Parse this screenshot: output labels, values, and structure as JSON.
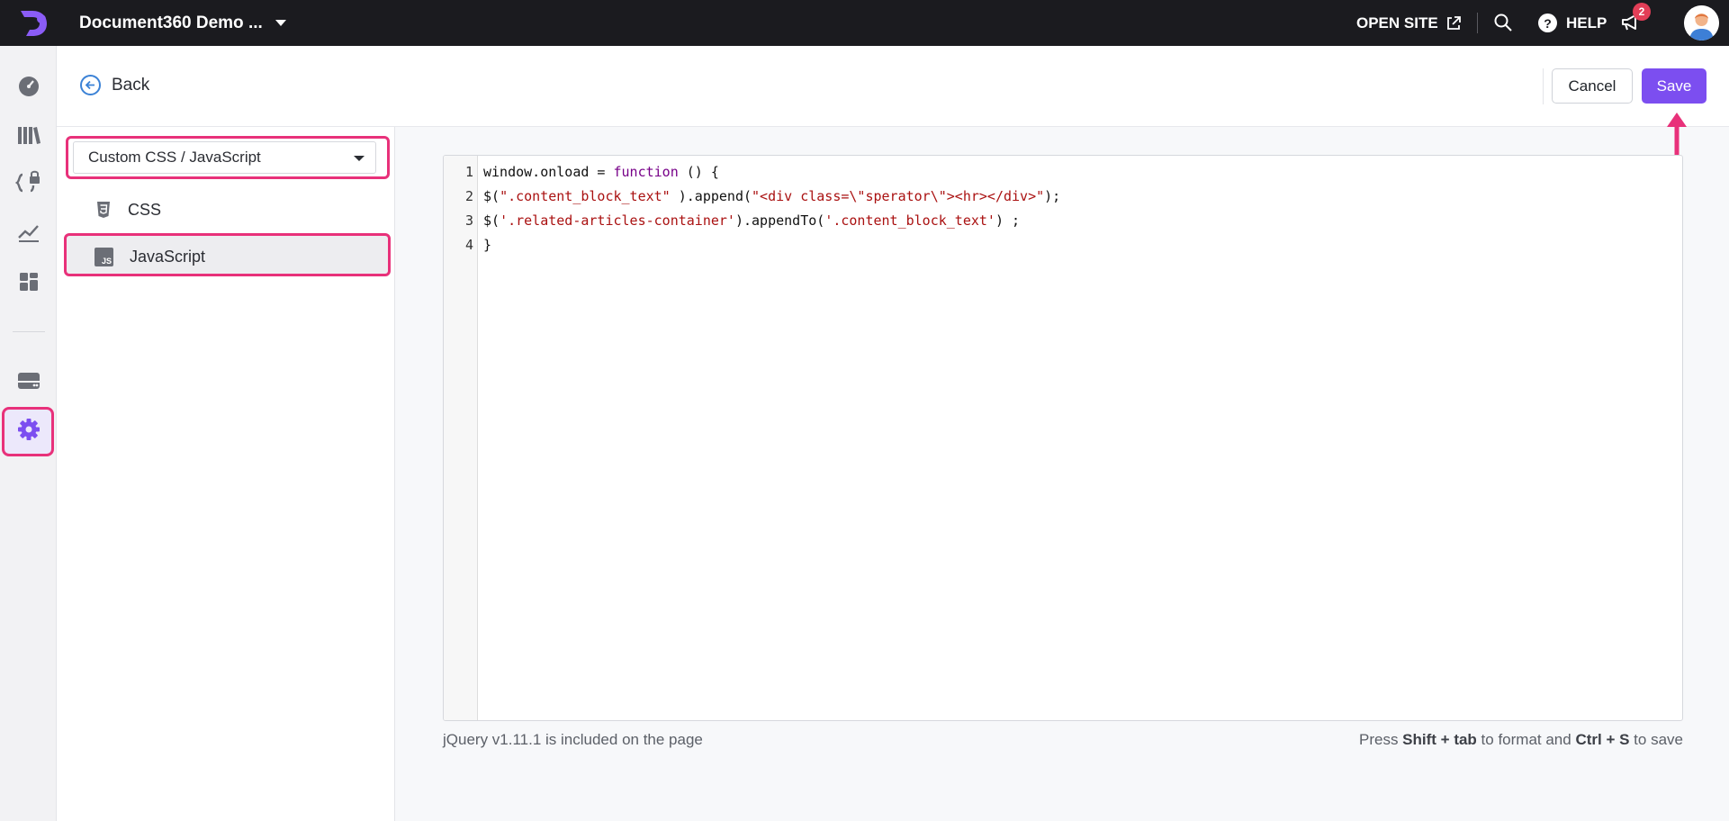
{
  "topbar": {
    "project_name": "Document360 Demo ...",
    "open_site_label": "OPEN SITE",
    "help_label": "HELP",
    "notification_count": "2"
  },
  "header": {
    "back_label": "Back",
    "cancel_label": "Cancel",
    "save_label": "Save"
  },
  "sidebar_panel": {
    "selected_option": "Custom CSS / JavaScript",
    "items": [
      {
        "label": "CSS",
        "icon": "css3-icon"
      },
      {
        "label": "JavaScript",
        "icon": "js-file-icon",
        "active": true
      }
    ]
  },
  "editor": {
    "line_numbers": [
      "1",
      "2",
      "3",
      "4"
    ],
    "lines": [
      [
        {
          "t": "window.onload = ",
          "c": "plain"
        },
        {
          "t": "function",
          "c": "kw"
        },
        {
          "t": " () {",
          "c": "plain"
        }
      ],
      [
        {
          "t": "$(",
          "c": "plain"
        },
        {
          "t": "\".content_block_text\"",
          "c": "str"
        },
        {
          "t": " ).append(",
          "c": "plain"
        },
        {
          "t": "\"<div class=\\\"sperator\\\"><hr></div>\"",
          "c": "str"
        },
        {
          "t": ");",
          "c": "plain"
        }
      ],
      [
        {
          "t": "$(",
          "c": "plain"
        },
        {
          "t": "'.related-articles-container'",
          "c": "str"
        },
        {
          "t": ").appendTo(",
          "c": "plain"
        },
        {
          "t": "'.content_block_text'",
          "c": "str"
        },
        {
          "t": ") ;",
          "c": "plain"
        }
      ],
      [
        {
          "t": "}",
          "c": "plain"
        }
      ]
    ]
  },
  "footer": {
    "jquery_note": "jQuery v1.11.1 is included on the page",
    "hint_press": "Press ",
    "hint_key1": "Shift + tab",
    "hint_mid": " to format and ",
    "hint_key2": "Ctrl + S",
    "hint_end": " to save"
  },
  "colors": {
    "accent": "#7c4ef0",
    "highlight": "#e8317a",
    "topbar_bg": "#1b1b1f"
  }
}
